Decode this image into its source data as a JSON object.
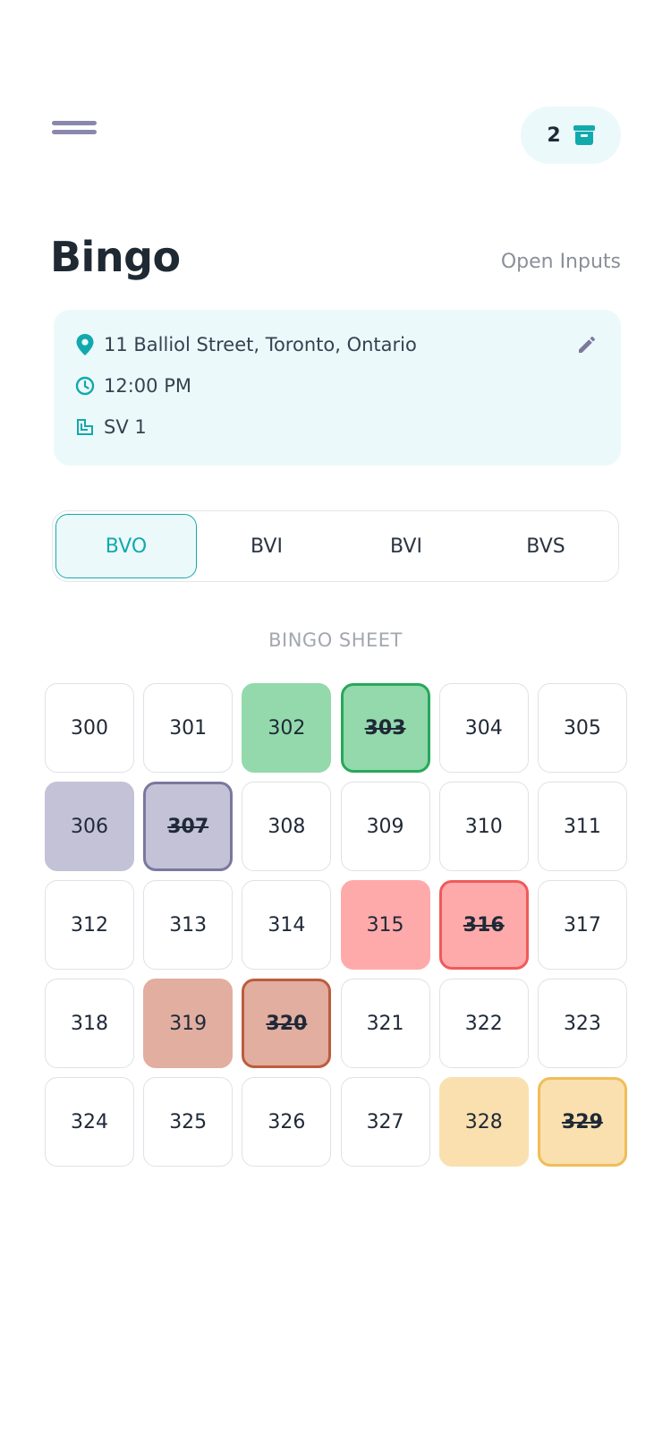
{
  "header": {
    "cart_count": "2"
  },
  "title": "Bingo",
  "open_inputs_label": "Open Inputs",
  "info": {
    "address": "11 Balliol Street, Toronto, Ontario",
    "time": "12:00 PM",
    "room": "SV 1"
  },
  "tabs": [
    {
      "label": "BVO",
      "active": true
    },
    {
      "label": "BVI",
      "active": false
    },
    {
      "label": "BVI",
      "active": false
    },
    {
      "label": "BVS",
      "active": false
    }
  ],
  "sheet_label": "BINGO SHEET",
  "colors": {
    "accent": "#12a9ad",
    "green_fill": "#93d9ac",
    "green_border": "#27a85a",
    "purple_fill": "#c4c2d6",
    "purple_border": "#7a779f",
    "red_fill": "#ffaaaa",
    "red_border": "#ef5a5a",
    "brown_fill": "#e1aea0",
    "brown_border": "#bd5c3e",
    "yellow_fill": "#f9e0ae",
    "yellow_border": "#f0bd57"
  },
  "cells": [
    {
      "number": "300"
    },
    {
      "number": "301"
    },
    {
      "number": "302",
      "fill": "green_fill"
    },
    {
      "number": "303",
      "fill": "green_fill",
      "border": "green_border",
      "struck": true
    },
    {
      "number": "304"
    },
    {
      "number": "305"
    },
    {
      "number": "306",
      "fill": "purple_fill"
    },
    {
      "number": "307",
      "fill": "purple_fill",
      "border": "purple_border",
      "struck": true
    },
    {
      "number": "308"
    },
    {
      "number": "309"
    },
    {
      "number": "310"
    },
    {
      "number": "311"
    },
    {
      "number": "312"
    },
    {
      "number": "313"
    },
    {
      "number": "314"
    },
    {
      "number": "315",
      "fill": "red_fill"
    },
    {
      "number": "316",
      "fill": "red_fill",
      "border": "red_border",
      "struck": true
    },
    {
      "number": "317"
    },
    {
      "number": "318"
    },
    {
      "number": "319",
      "fill": "brown_fill"
    },
    {
      "number": "320",
      "fill": "brown_fill",
      "border": "brown_border",
      "struck": true
    },
    {
      "number": "321"
    },
    {
      "number": "322"
    },
    {
      "number": "323"
    },
    {
      "number": "324"
    },
    {
      "number": "325"
    },
    {
      "number": "326"
    },
    {
      "number": "327"
    },
    {
      "number": "328",
      "fill": "yellow_fill"
    },
    {
      "number": "329",
      "fill": "yellow_fill",
      "border": "yellow_border",
      "struck": true
    }
  ]
}
